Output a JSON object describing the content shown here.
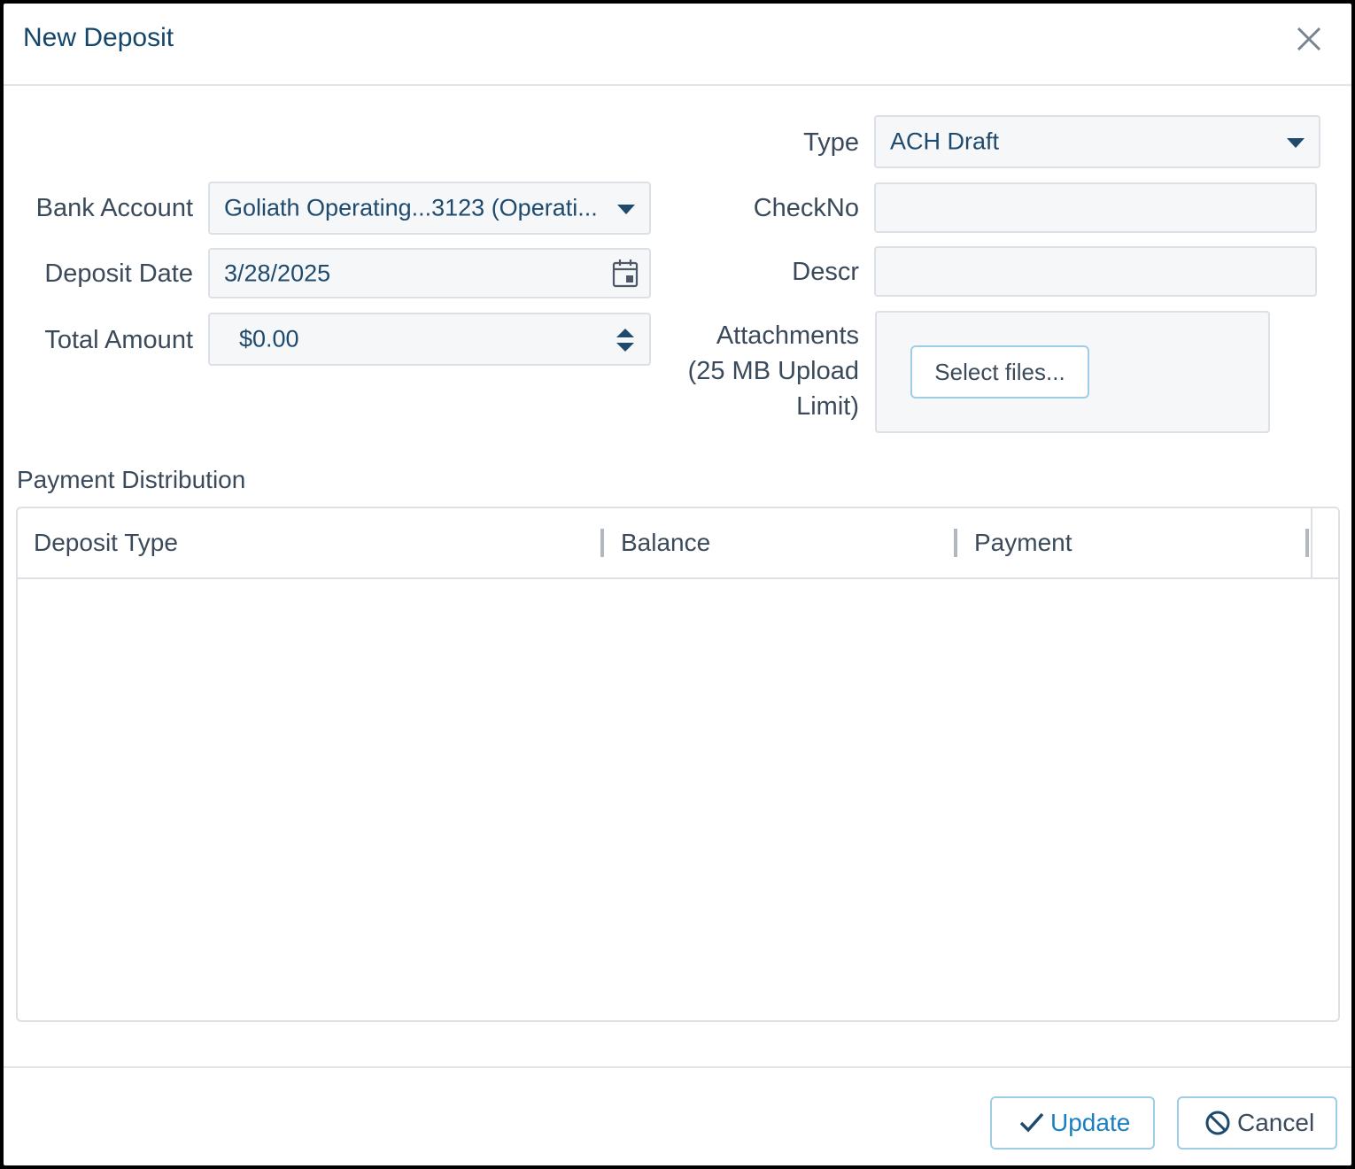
{
  "dialog": {
    "title": "New Deposit",
    "close_icon": "close-icon"
  },
  "form": {
    "type_label": "Type",
    "type_value": "ACH Draft",
    "bank_account_label": "Bank Account",
    "bank_account_value": "Goliath Operating...3123 (Operati...",
    "checkno_label": "CheckNo",
    "checkno_value": "",
    "deposit_date_label": "Deposit Date",
    "deposit_date_value": "3/28/2025",
    "descr_label": "Descr",
    "descr_value": "",
    "total_amount_label": "Total Amount",
    "total_amount_value": "$0.00",
    "attachments_label_line1": "Attachments",
    "attachments_label_line2": "(25 MB Upload",
    "attachments_label_line3": "Limit)",
    "select_files_label": "Select files..."
  },
  "payment_distribution": {
    "title": "Payment Distribution",
    "columns": [
      "Deposit Type",
      "Balance",
      "Payment"
    ],
    "rows": []
  },
  "footer": {
    "update_label": "Update",
    "cancel_label": "Cancel"
  },
  "colors": {
    "title": "#14466b",
    "label": "#3b4a5a",
    "value": "#1e4a6e",
    "accent": "#1a7fc1",
    "field_bg": "#f6f7f9",
    "border": "#dde0e5",
    "button_border": "#9fcde6"
  }
}
